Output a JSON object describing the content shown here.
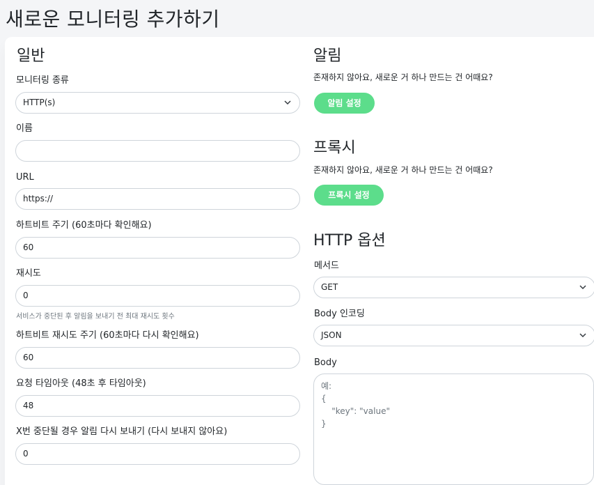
{
  "page": {
    "title": "새로운 모니터링 추가하기"
  },
  "general": {
    "heading": "일반",
    "monitor_type": {
      "label": "모니터링 종류",
      "value": "HTTP(s)"
    },
    "name": {
      "label": "이름",
      "value": ""
    },
    "url": {
      "label": "URL",
      "value": "https://"
    },
    "heartbeat_interval": {
      "label": "하트비트 주기 (60초마다 확인해요)",
      "value": "60"
    },
    "retries": {
      "label": "재시도",
      "value": "0",
      "help": "서비스가 중단된 후 알림을 보내기 전 최대 재시도 횟수"
    },
    "retry_interval": {
      "label": "하트비트 재시도 주기 (60초마다 다시 확인해요)",
      "value": "60"
    },
    "timeout": {
      "label": "요청 타임아웃 (48초 후 타임아웃)",
      "value": "48"
    },
    "resend": {
      "label": "X번 중단될 경우 알림 다시 보내기 (다시 보내지 않아요)",
      "value": "0"
    }
  },
  "notifications": {
    "heading": "알림",
    "empty_text": "존재하지 않아요, 새로운 거 하나 만드는 건 어때요?",
    "button": "알림 설정"
  },
  "proxy": {
    "heading": "프록시",
    "empty_text": "존재하지 않아요, 새로운 거 하나 만드는 건 어때요?",
    "button": "프록시 설정"
  },
  "http_options": {
    "heading": "HTTP 옵션",
    "method": {
      "label": "메서드",
      "value": "GET"
    },
    "body_encoding": {
      "label": "Body 인코딩",
      "value": "JSON"
    },
    "body": {
      "label": "Body",
      "placeholder": "예:\n{\n    \"key\": \"value\"\n}"
    }
  },
  "colors": {
    "accent": "#5cdd8b",
    "border": "#ced4da"
  },
  "icons": {
    "select_arrow": "chevron-down-icon"
  }
}
